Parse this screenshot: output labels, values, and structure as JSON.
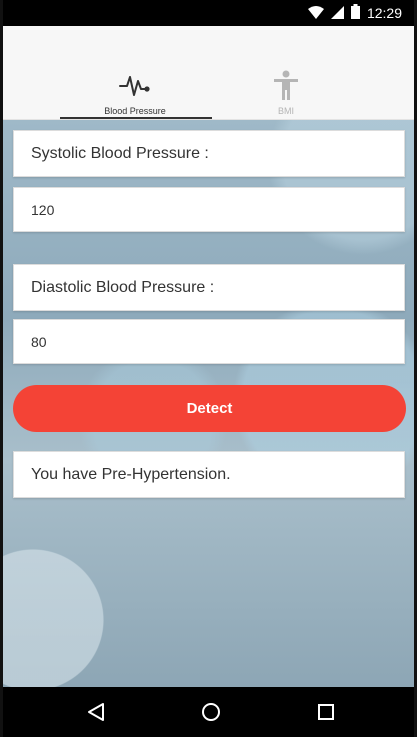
{
  "status_bar": {
    "time": "12:29",
    "icons": [
      "wifi-icon",
      "signal-icon",
      "battery-icon"
    ]
  },
  "tabs": [
    {
      "label": "Blood Pressure",
      "icon": "heartbeat-icon",
      "active": true
    },
    {
      "label": "BMI",
      "icon": "person-icon",
      "active": false
    }
  ],
  "form": {
    "systolic_label": "Systolic Blood Pressure :",
    "systolic_value": "120",
    "diastolic_label": "Diastolic Blood Pressure :",
    "diastolic_value": "80",
    "detect_label": "Detect",
    "result_text": "You have Pre-Hypertension."
  },
  "nav": {
    "icons": [
      "back-icon",
      "home-icon",
      "recents-icon"
    ]
  },
  "colors": {
    "accent": "#f44336",
    "active_tab": "#333333",
    "inactive_tab": "#b5b5b5"
  }
}
